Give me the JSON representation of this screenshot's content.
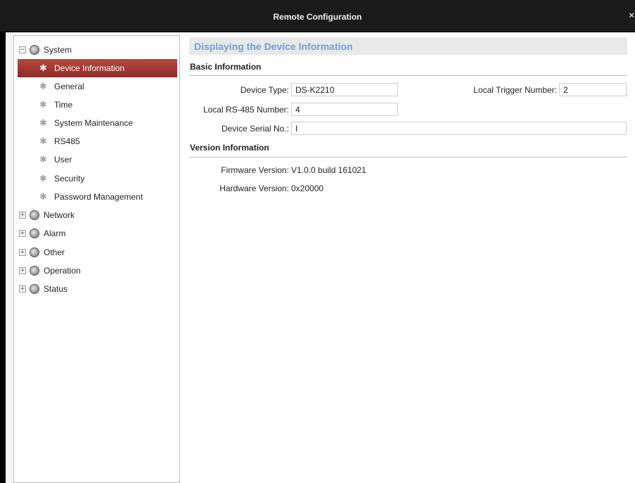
{
  "window": {
    "title": "Remote Configuration",
    "close_glyph": "×"
  },
  "sidebar": {
    "system": {
      "label": "System",
      "expander": "−"
    },
    "system_children": [
      {
        "label": "Device Information",
        "selected": true
      },
      {
        "label": "General"
      },
      {
        "label": "Time"
      },
      {
        "label": "System Maintenance"
      },
      {
        "label": "RS485"
      },
      {
        "label": "User"
      },
      {
        "label": "Security"
      },
      {
        "label": "Password Management"
      }
    ],
    "groups": [
      {
        "label": "Network",
        "expander": "+"
      },
      {
        "label": "Alarm",
        "expander": "+"
      },
      {
        "label": "Other",
        "expander": "+"
      },
      {
        "label": "Operation",
        "expander": "+"
      },
      {
        "label": "Status",
        "expander": "+"
      }
    ]
  },
  "main": {
    "header": "Displaying the Device Information",
    "basic_info": {
      "title": "Basic Information",
      "device_type_label": "Device Type:",
      "device_type_value": "DS-K2210",
      "local_trigger_label": "Local Trigger Number:",
      "local_trigger_value": "2",
      "rs485_label": "Local RS-485 Number:",
      "rs485_value": "4",
      "serial_label": "Device Serial No.:",
      "serial_value": "I"
    },
    "version_info": {
      "title": "Version Information",
      "firmware_label": "Firmware Version:",
      "firmware_value": "V1.0.0 build 161021",
      "hardware_label": "Hardware Version:",
      "hardware_value": "0x20000"
    }
  },
  "colors": {
    "selected_row": "#a3352f",
    "header_text": "#6f9ed1",
    "title_bar": "#1b1b1b"
  },
  "icons": {
    "tree_group": "globe-icon",
    "tree_item": "gear-icon",
    "expand": "plus-expander-icon",
    "collapse": "minus-expander-icon"
  }
}
